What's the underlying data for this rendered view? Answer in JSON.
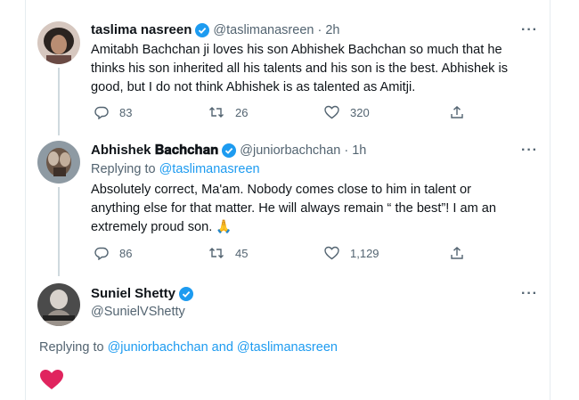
{
  "tweets": [
    {
      "name": "taslima nasreen",
      "handle": "@taslimanasreen",
      "separator": "·",
      "time": "2h",
      "text": "Amitabh Bachchan ji loves his son Abhishek Bachchan so much that he thinks his son inherited all his talents and his son is the best.  Abhishek is good, but I do not think Abhishek is as talented as Amitji.",
      "text_lines": [
        "Amitabh Bachchan ji loves his son Abhishek Bachchan so much that he",
        "thinks his son inherited all his talents and his son is the best.  Abhishek is",
        "good, but I do not think Abhishek is as talented as Amitji."
      ],
      "replies": "83",
      "retweets": "26",
      "likes": "320"
    },
    {
      "name": "Abhishek 𝐁𝐚𝐜𝐡𝐜𝐡𝐚𝐧",
      "handle": "@juniorbachchan",
      "separator": "·",
      "time": "1h",
      "replying_prefix": "Replying to ",
      "replying_to": "@taslimanasreen",
      "text_lines": [
        "Absolutely correct, Ma'am. Nobody comes close to him in talent or",
        "anything else for that matter. He will always remain “ the best”! I am an",
        "extremely proud son. 🙏"
      ],
      "replies": "86",
      "retweets": "45",
      "likes": "1,129"
    },
    {
      "name": "Suniel Shetty",
      "handle": "@SunielVShetty",
      "replying_prefix": "Replying to ",
      "replying_to_1": "@juniorbachchan",
      "replying_and": " and ",
      "replying_to_2": "@taslimanasreen",
      "reaction": "❤️"
    }
  ],
  "more_label": "···",
  "colors": {
    "accent": "#1d9bf0",
    "muted": "#536471",
    "heart": "#e0245e",
    "verified": "#1d9bf0"
  },
  "icons": [
    "reply-icon",
    "retweet-icon",
    "like-icon",
    "share-icon",
    "verified-badge-icon",
    "more-icon",
    "heart-emoji-icon"
  ]
}
